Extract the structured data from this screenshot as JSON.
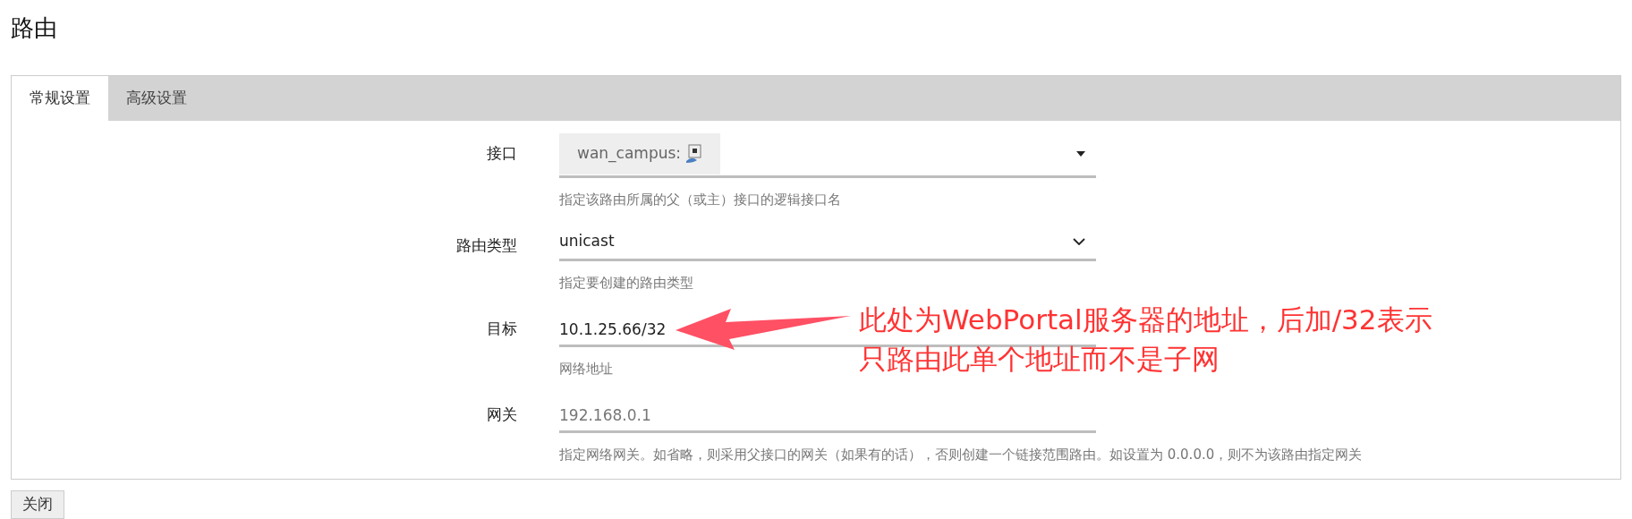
{
  "page_title": "路由",
  "tabs": [
    {
      "label": "常规设置",
      "selected": true
    },
    {
      "label": "高级设置",
      "selected": false
    }
  ],
  "fields": [
    {
      "kind": "interface",
      "label": "接口",
      "value": "wan_campus:",
      "description": "指定该路由所属的父（或主）接口的逻辑接口名"
    },
    {
      "kind": "select",
      "label": "路由类型",
      "value": "unicast",
      "description": "指定要创建的路由类型"
    },
    {
      "kind": "text",
      "label": "目标",
      "value": "10.1.25.66/32",
      "description": "网络地址"
    },
    {
      "kind": "text",
      "label": "网关",
      "placeholder": "192.168.0.1",
      "description": "指定网络网关。如省略，则采用父接口的网关（如果有的话），否则创建一个链接范围路由。如设置为 0.0.0.0，则不为该路由指定网关"
    }
  ],
  "annotation": {
    "lines": [
      "此处为WebPortal服务器的地址，后加/32表示",
      "只路由此单个地址而不是子网"
    ]
  },
  "buttons": [
    "关闭"
  ]
}
